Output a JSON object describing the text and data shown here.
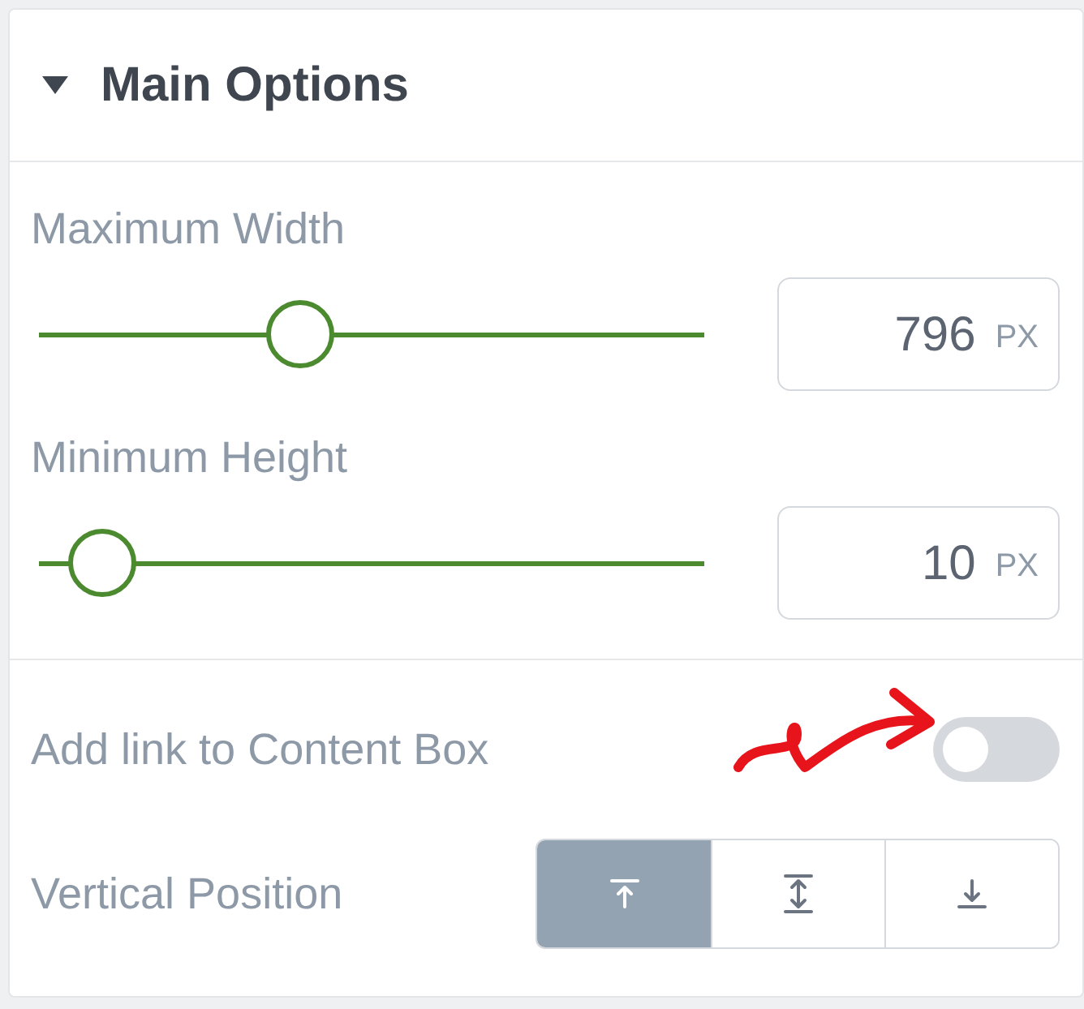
{
  "section": {
    "title": "Main Options",
    "expanded": true
  },
  "sliders": [
    {
      "label": "Maximum Width",
      "level": 0.38,
      "value": "796",
      "unit": "PX"
    },
    {
      "label": "Minimum Height",
      "level": 0.05,
      "value": "10",
      "unit": "PX"
    }
  ],
  "toggle": {
    "label": "Add link to Content Box",
    "on": false
  },
  "vertical_position": {
    "label": "Vertical Position",
    "options": [
      {
        "kind": "top",
        "selected": true
      },
      {
        "kind": "middle",
        "selected": false
      },
      {
        "kind": "bottom",
        "selected": false
      }
    ]
  }
}
